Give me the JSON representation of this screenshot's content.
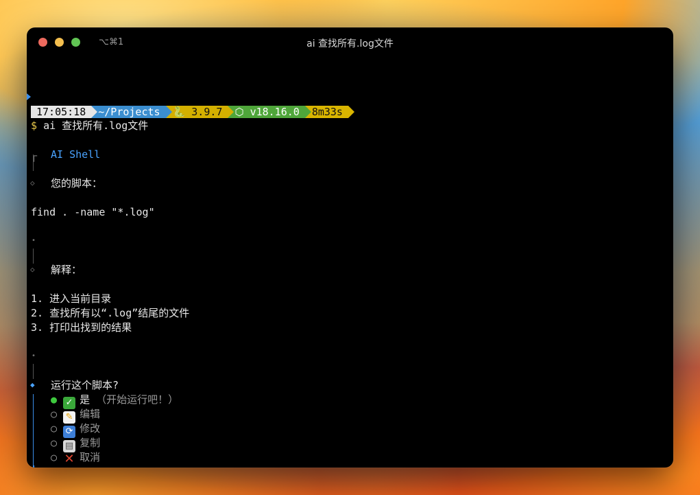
{
  "window": {
    "shortcut": "⌥⌘1",
    "title": "ai 查找所有.log文件"
  },
  "prompt": {
    "time": "17:05:18",
    "dir": "~/Projects",
    "python": "🐍 3.9.7",
    "node": "⬡ v18.16.0",
    "duration": "8m33s",
    "symbol": "$",
    "command": "ai 查找所有.log文件"
  },
  "app": {
    "name": "AI Shell",
    "script_label": "您的脚本：",
    "script": "find . -name \"*.log\"",
    "explain_label": "解释：",
    "explanation": [
      "1. 进入当前目录",
      "2. 查找所有以“.log”结尾的文件",
      "3. 打印出找到的结果"
    ],
    "question": "运行这个脚本?",
    "options": [
      {
        "icon": "check-icon",
        "label": "是",
        "hint": "（开始运行吧！）"
      },
      {
        "icon": "memo-icon",
        "label": "编辑"
      },
      {
        "icon": "repeat-icon",
        "label": "修改"
      },
      {
        "icon": "clipboard-icon",
        "label": "复制"
      },
      {
        "icon": "cross-icon",
        "label": "取消"
      }
    ]
  },
  "colors": {
    "accent_blue": "#4aa3ff",
    "selected_green": "#3ec83e"
  }
}
